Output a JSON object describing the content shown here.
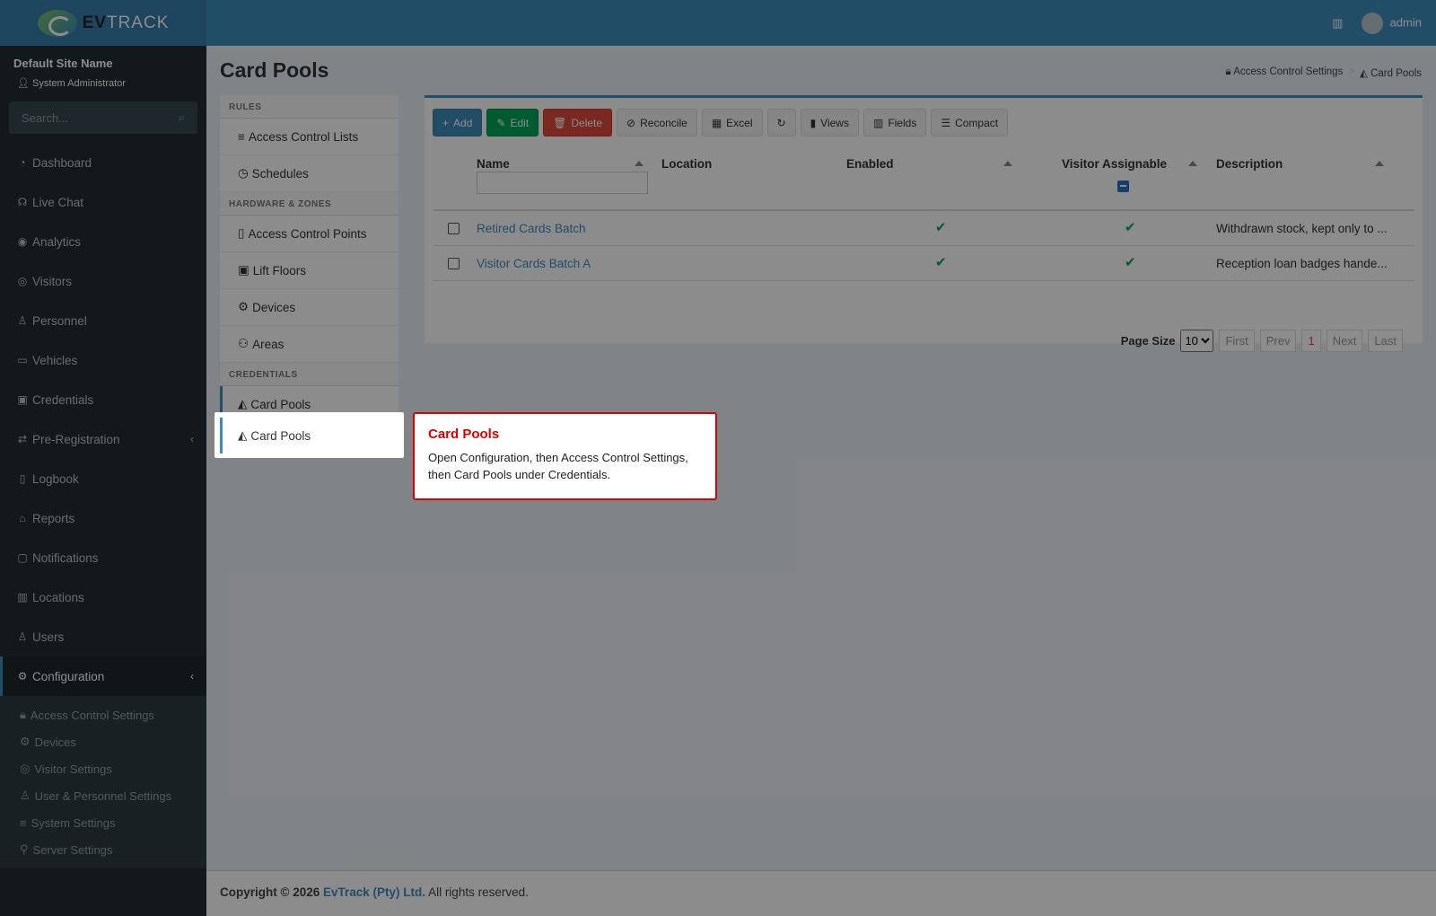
{
  "brand": {
    "logo_prefix": "EV",
    "logo_suffix": "TRACK"
  },
  "site": {
    "name": "Default Site Name",
    "role": "System Administrator"
  },
  "search": {
    "placeholder": "Search..."
  },
  "topbar": {
    "user": "admin"
  },
  "nav": [
    {
      "label": "Dashboard",
      "icon": "dashboard-icon"
    },
    {
      "label": "Live Chat",
      "icon": "headset-icon"
    },
    {
      "label": "Analytics",
      "icon": "analytics-icon"
    },
    {
      "label": "Visitors",
      "icon": "eye-icon"
    },
    {
      "label": "Personnel",
      "icon": "person-icon"
    },
    {
      "label": "Vehicles",
      "icon": "car-icon"
    },
    {
      "label": "Credentials",
      "icon": "id-card-icon"
    },
    {
      "label": "Pre-Registration",
      "icon": "arrows-icon"
    },
    {
      "label": "Logbook",
      "icon": "book-icon"
    },
    {
      "label": "Reports",
      "icon": "chart-icon"
    },
    {
      "label": "Notifications",
      "icon": "chat-icon"
    },
    {
      "label": "Locations",
      "icon": "map-icon"
    },
    {
      "label": "Users",
      "icon": "users-icon"
    },
    {
      "label": "Configuration",
      "icon": "gear-icon"
    }
  ],
  "config_sub": [
    {
      "label": "Access Control Settings",
      "icon": "lock-icon"
    },
    {
      "label": "Devices",
      "icon": "device-icon"
    },
    {
      "label": "Visitor Settings",
      "icon": "eye-icon"
    },
    {
      "label": "User & Personnel Settings",
      "icon": "user-gear-icon"
    },
    {
      "label": "System Settings",
      "icon": "sliders-icon"
    },
    {
      "label": "Server Settings",
      "icon": "server-icon"
    }
  ],
  "page": {
    "title": "Card Pools"
  },
  "breadcrumb": {
    "parent": "Access Control Settings",
    "current": "Card Pools",
    "separator": ">"
  },
  "rules_panel": {
    "h_rules": "RULES",
    "acl": "Access Control Lists",
    "schedules": "Schedules",
    "h_hardware": "HARDWARE & ZONES",
    "acp": "Access Control Points",
    "lift": "Lift Floors",
    "devices": "Devices",
    "areas": "Areas",
    "h_credentials": "CREDENTIALS",
    "card_pools": "Card Pools"
  },
  "toolbar": {
    "add": "Add",
    "edit": "Edit",
    "delete": "Delete",
    "reconcile": "Reconcile",
    "excel": "Excel",
    "views": "Views",
    "fields": "Fields",
    "compact": "Compact"
  },
  "grid": {
    "columns": [
      "Name",
      "Location",
      "Enabled",
      "Visitor Assignable",
      "Description"
    ],
    "rows": [
      {
        "name": "Retired Cards Batch",
        "location": "",
        "enabled": true,
        "visitor_assignable": true,
        "description": "Withdrawn stock, kept only to ..."
      },
      {
        "name": "Visitor Cards Batch A",
        "location": "",
        "enabled": true,
        "visitor_assignable": true,
        "description": "Reception loan badges hande..."
      }
    ]
  },
  "pager": {
    "label": "Page Size",
    "size": "10",
    "first": "First",
    "prev": "Prev",
    "page": "1",
    "next": "Next",
    "last": "Last"
  },
  "tooltip": {
    "title": "Card Pools",
    "body": "Open Configuration, then Access Control Settings, then Card Pools under Credentials."
  },
  "footer": {
    "prefix": "Copyright © 2026",
    "company": "EvTrack (Pty) Ltd.",
    "suffix": "All rights reserved."
  }
}
